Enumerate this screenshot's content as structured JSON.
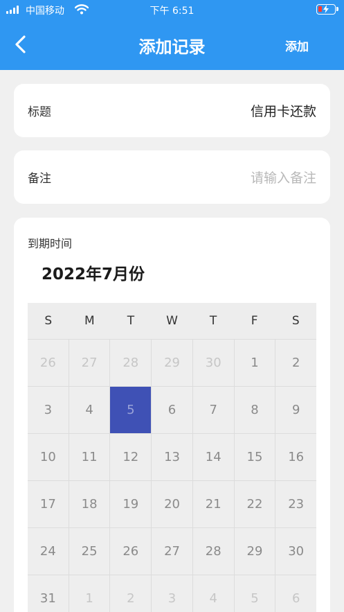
{
  "status_bar": {
    "carrier": "中国移动",
    "time": "下午 6:51"
  },
  "nav": {
    "title": "添加记录",
    "add_label": "添加"
  },
  "form": {
    "title_label": "标题",
    "title_value": "信用卡还款",
    "note_label": "备注",
    "note_placeholder": "请输入备注",
    "due_label": "到期时间"
  },
  "calendar": {
    "month_title": "2022年7月份",
    "weekdays": [
      "S",
      "M",
      "T",
      "W",
      "T",
      "F",
      "S"
    ],
    "selected_day": "5",
    "weeks": [
      [
        {
          "d": "26",
          "m": true
        },
        {
          "d": "27",
          "m": true
        },
        {
          "d": "28",
          "m": true
        },
        {
          "d": "29",
          "m": true
        },
        {
          "d": "30",
          "m": true
        },
        {
          "d": "1"
        },
        {
          "d": "2"
        }
      ],
      [
        {
          "d": "3"
        },
        {
          "d": "4"
        },
        {
          "d": "5",
          "s": true
        },
        {
          "d": "6"
        },
        {
          "d": "7"
        },
        {
          "d": "8"
        },
        {
          "d": "9"
        }
      ],
      [
        {
          "d": "10"
        },
        {
          "d": "11"
        },
        {
          "d": "12"
        },
        {
          "d": "13"
        },
        {
          "d": "14"
        },
        {
          "d": "15"
        },
        {
          "d": "16"
        }
      ],
      [
        {
          "d": "17"
        },
        {
          "d": "18"
        },
        {
          "d": "19"
        },
        {
          "d": "20"
        },
        {
          "d": "21"
        },
        {
          "d": "22"
        },
        {
          "d": "23"
        }
      ],
      [
        {
          "d": "24"
        },
        {
          "d": "25"
        },
        {
          "d": "26"
        },
        {
          "d": "27"
        },
        {
          "d": "28"
        },
        {
          "d": "29"
        },
        {
          "d": "30"
        }
      ],
      [
        {
          "d": "31"
        },
        {
          "d": "1",
          "m": true
        },
        {
          "d": "2",
          "m": true
        },
        {
          "d": "3",
          "m": true
        },
        {
          "d": "4",
          "m": true
        },
        {
          "d": "5",
          "m": true
        },
        {
          "d": "6",
          "m": true
        }
      ]
    ]
  },
  "colors": {
    "header": "#2f97f2",
    "selected": "#3f51b5",
    "background": "#f0f0f0"
  }
}
